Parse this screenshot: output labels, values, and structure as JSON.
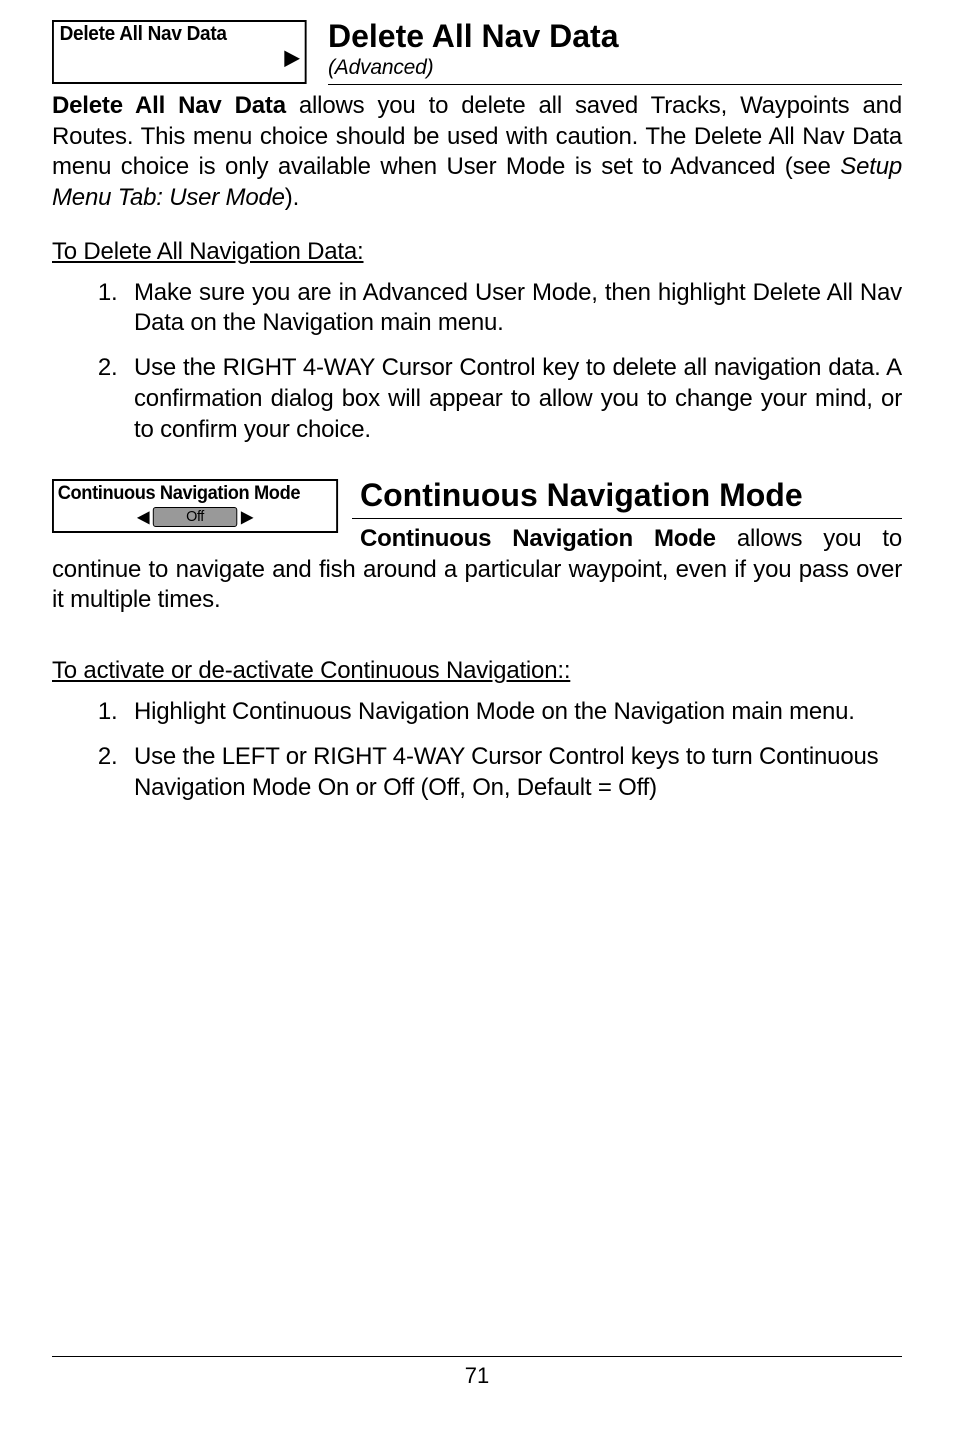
{
  "section1": {
    "menuLabel": "Delete All Nav Data",
    "title": "Delete All Nav Data",
    "subtitle": "(Advanced)",
    "paragraphLead": "Delete All Nav Data",
    "paragraphRest": " allows you to delete all saved Tracks, Waypoints and Routes. This menu choice should be used with caution. The Delete All Nav Data menu choice is only available when User Mode is set to Advanced (see ",
    "paragraphItalic": "Setup Menu Tab: User Mode",
    "paragraphEnd": ").",
    "stepsHeading": "To Delete All Navigation Data:",
    "steps": [
      "Make sure you are in Advanced User Mode, then highlight Delete All Nav Data on the Navigation main menu.",
      "Use the RIGHT 4-WAY Cursor Control key to delete all navigation data. A confirmation dialog box will appear to allow you to change your mind, or to confirm your choice."
    ]
  },
  "section2": {
    "menuLabel": "Continuous Navigation Mode",
    "pill": "Off",
    "title": "Continuous Navigation Mode",
    "paragraphLead": "Continuous Navigation Mode",
    "paragraphRest": " allows you to continue to navigate and fish around a particular waypoint, even if you pass over it multiple times.",
    "stepsHeading": "To activate or de-activate Continuous Navigation::",
    "steps": [
      "Highlight Continuous Navigation Mode on the Navigation main menu.",
      "Use the LEFT or RIGHT 4-WAY Cursor Control keys to turn Continuous Navigation Mode On or Off (Off, On, Default = Off)"
    ]
  },
  "pageNumber": "71"
}
